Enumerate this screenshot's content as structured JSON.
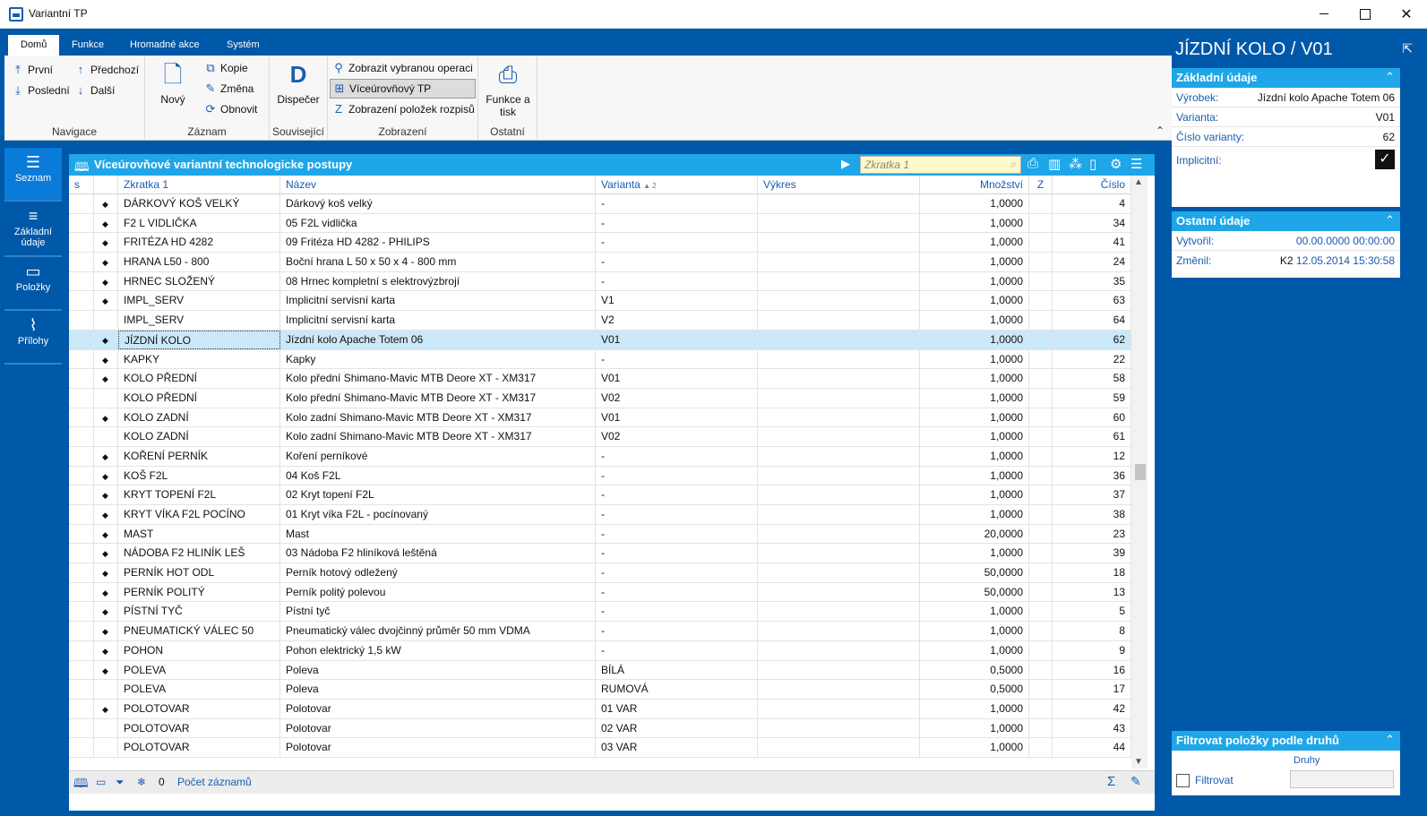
{
  "window": {
    "title": "Variantní TP"
  },
  "ribbon": {
    "tabs": [
      "Domů",
      "Funkce",
      "Hromadné akce",
      "Systém"
    ],
    "navigace": {
      "label": "Navigace",
      "prvni": "První",
      "posledni": "Poslední",
      "predchozi": "Předchozí",
      "dalsi": "Další"
    },
    "zaznam": {
      "label": "Záznam",
      "novy": "Nový",
      "kopie": "Kopie",
      "zmena": "Změna",
      "obnovit": "Obnovit"
    },
    "souvisejici": {
      "label": "Související",
      "dispecer": "Dispečer"
    },
    "zobrazeni": {
      "label": "Zobrazení",
      "zobrazit_operaci": "Zobrazit vybranou operaci",
      "viceurovnovy": "Víceúrovňový TP",
      "zobrazeni_polozek": "Zobrazení položek rozpisů"
    },
    "ostatni": {
      "label": "Ostatní",
      "funkce_tisk_1": "Funkce a",
      "funkce_tisk_2": "tisk"
    }
  },
  "leftnav": {
    "items": [
      "Seznam",
      "Základní údaje",
      "Položky",
      "Přílohy"
    ]
  },
  "grid": {
    "title": "Víceúrovňové variantní technologicke postupy",
    "search_placeholder": "Zkratka 1",
    "columns": {
      "s": "s",
      "zkratka": "Zkratka 1",
      "nazev": "Název",
      "varianta": "Varianta",
      "varianta_sort": "▲ 2",
      "vykres": "Výkres",
      "mnozstvi": "Množství",
      "z": "Z",
      "cislo": "Číslo"
    },
    "rows": [
      {
        "d": true,
        "zkratka": "DÁRKOVÝ KOŠ VELKÝ",
        "nazev": "Dárkový koš velký",
        "varianta": "-",
        "mnozstvi": "1,0000",
        "cislo": "4"
      },
      {
        "d": true,
        "zkratka": "F2 L VIDLIČKA",
        "nazev": "05 F2L vidlička",
        "varianta": "-",
        "mnozstvi": "1,0000",
        "cislo": "34"
      },
      {
        "d": true,
        "zkratka": "FRITÉZA HD 4282",
        "nazev": "09 Fritéza HD 4282 - PHILIPS",
        "varianta": "-",
        "mnozstvi": "1,0000",
        "cislo": "41"
      },
      {
        "d": true,
        "zkratka": "HRANA L50 - 800",
        "nazev": "Boční hrana L 50 x 50 x 4 - 800 mm",
        "varianta": "-",
        "mnozstvi": "1,0000",
        "cislo": "24"
      },
      {
        "d": true,
        "zkratka": "HRNEC SLOŽENÝ",
        "nazev": "08 Hrnec kompletní s elektrovýzbrojí",
        "varianta": "-",
        "mnozstvi": "1,0000",
        "cislo": "35"
      },
      {
        "d": true,
        "zkratka": "IMPL_SERV",
        "nazev": "Implicitní servisní karta",
        "varianta": "V1",
        "mnozstvi": "1,0000",
        "cislo": "63"
      },
      {
        "d": false,
        "zkratka": "IMPL_SERV",
        "nazev": "Implicitní servisní karta",
        "varianta": "V2",
        "mnozstvi": "1,0000",
        "cislo": "64"
      },
      {
        "d": true,
        "zkratka": "JÍZDNÍ KOLO",
        "nazev": "Jízdní kolo Apache Totem 06",
        "varianta": "V01",
        "mnozstvi": "1,0000",
        "cislo": "62",
        "sel": true
      },
      {
        "d": true,
        "zkratka": "KAPKY",
        "nazev": "Kapky",
        "varianta": "-",
        "mnozstvi": "1,0000",
        "cislo": "22"
      },
      {
        "d": true,
        "zkratka": "KOLO PŘEDNÍ",
        "nazev": "Kolo přední Shimano-Mavic MTB Deore XT - XM317",
        "varianta": "V01",
        "mnozstvi": "1,0000",
        "cislo": "58"
      },
      {
        "d": false,
        "zkratka": "KOLO PŘEDNÍ",
        "nazev": "Kolo přední Shimano-Mavic MTB Deore XT - XM317",
        "varianta": "V02",
        "mnozstvi": "1,0000",
        "cislo": "59"
      },
      {
        "d": true,
        "zkratka": "KOLO ZADNÍ",
        "nazev": "Kolo zadní Shimano-Mavic MTB Deore XT - XM317",
        "varianta": "V01",
        "mnozstvi": "1,0000",
        "cislo": "60"
      },
      {
        "d": false,
        "zkratka": "KOLO ZADNÍ",
        "nazev": "Kolo zadní Shimano-Mavic MTB Deore XT - XM317",
        "varianta": "V02",
        "mnozstvi": "1,0000",
        "cislo": "61"
      },
      {
        "d": true,
        "zkratka": "KOŘENÍ PERNÍK",
        "nazev": "Koření perníkové",
        "varianta": "-",
        "mnozstvi": "1,0000",
        "cislo": "12"
      },
      {
        "d": true,
        "zkratka": "KOŠ F2L",
        "nazev": "04 Koš F2L",
        "varianta": "-",
        "mnozstvi": "1,0000",
        "cislo": "36"
      },
      {
        "d": true,
        "zkratka": "KRYT TOPENÍ F2L",
        "nazev": "02 Kryt topení F2L",
        "varianta": "-",
        "mnozstvi": "1,0000",
        "cislo": "37"
      },
      {
        "d": true,
        "zkratka": "KRYT VÍKA F2L POCÍNO",
        "nazev": "01 Kryt víka F2L - pocínovaný",
        "varianta": "-",
        "mnozstvi": "1,0000",
        "cislo": "38"
      },
      {
        "d": true,
        "zkratka": "MAST",
        "nazev": "Mast",
        "varianta": "-",
        "mnozstvi": "20,0000",
        "cislo": "23"
      },
      {
        "d": true,
        "zkratka": "NÁDOBA F2 HLINÍK LEŠ",
        "nazev": "03 Nádoba F2 hliníková leštěná",
        "varianta": "-",
        "mnozstvi": "1,0000",
        "cislo": "39"
      },
      {
        "d": true,
        "zkratka": "PERNÍK HOT ODL",
        "nazev": "Perník hotový odležený",
        "varianta": "-",
        "mnozstvi": "50,0000",
        "cislo": "18"
      },
      {
        "d": true,
        "zkratka": "PERNÍK POLITÝ",
        "nazev": "Perník politý polevou",
        "varianta": "-",
        "mnozstvi": "50,0000",
        "cislo": "13"
      },
      {
        "d": true,
        "zkratka": "PÍSTNÍ TYČ",
        "nazev": "Pístní tyč",
        "varianta": "-",
        "mnozstvi": "1,0000",
        "cislo": "5"
      },
      {
        "d": true,
        "zkratka": "PNEUMATICKÝ VÁLEC 50",
        "nazev": "Pneumatický válec dvojčinný průměr 50 mm VDMA",
        "varianta": "-",
        "mnozstvi": "1,0000",
        "cislo": "8"
      },
      {
        "d": true,
        "zkratka": "POHON",
        "nazev": "Pohon elektrický 1,5 kW",
        "varianta": "-",
        "mnozstvi": "1,0000",
        "cislo": "9"
      },
      {
        "d": true,
        "zkratka": "POLEVA",
        "nazev": "Poleva",
        "varianta": "BÍLÁ",
        "mnozstvi": "0,5000",
        "cislo": "16"
      },
      {
        "d": false,
        "zkratka": "POLEVA",
        "nazev": "Poleva",
        "varianta": "RUMOVÁ",
        "mnozstvi": "0,5000",
        "cislo": "17"
      },
      {
        "d": true,
        "zkratka": "POLOTOVAR",
        "nazev": "Polotovar",
        "varianta": "01 VAR",
        "mnozstvi": "1,0000",
        "cislo": "42"
      },
      {
        "d": false,
        "zkratka": "POLOTOVAR",
        "nazev": "Polotovar",
        "varianta": "02 VAR",
        "mnozstvi": "1,0000",
        "cislo": "43"
      },
      {
        "d": false,
        "zkratka": "POLOTOVAR",
        "nazev": "Polotovar",
        "varianta": "03 VAR",
        "mnozstvi": "1,0000",
        "cislo": "44"
      }
    ],
    "footer": {
      "count": "0",
      "pocet_label": "Počet záznamů"
    }
  },
  "rightpanel": {
    "title": "JÍZDNÍ KOLO / V01",
    "zakladni": {
      "header": "Základní údaje",
      "vyrobek_label": "Výrobek:",
      "vyrobek": "Jízdní kolo Apache Totem 06",
      "varianta_label": "Varianta:",
      "varianta": "V01",
      "cislo_label": "Číslo varianty:",
      "cislo": "62",
      "implicitni_label": "Implicitní:"
    },
    "ostatni": {
      "header": "Ostatní údaje",
      "vytvoril_label": "Vytvořil:",
      "vytvoril": "00.00.0000 00:00:00",
      "zmenil_label": "Změnil:",
      "zmenil_user": "K2",
      "zmenil": "12.05.2014 15:30:58"
    },
    "filtr": {
      "header": "Filtrovat položky podle druhů",
      "druhy_label": "Druhy",
      "filtrovat_label": "Filtrovat"
    }
  },
  "colors": {
    "frame": "#0058a8",
    "header": "#1ea6e8",
    "selection": "#cbe8f8",
    "link": "#1a5cb0"
  }
}
